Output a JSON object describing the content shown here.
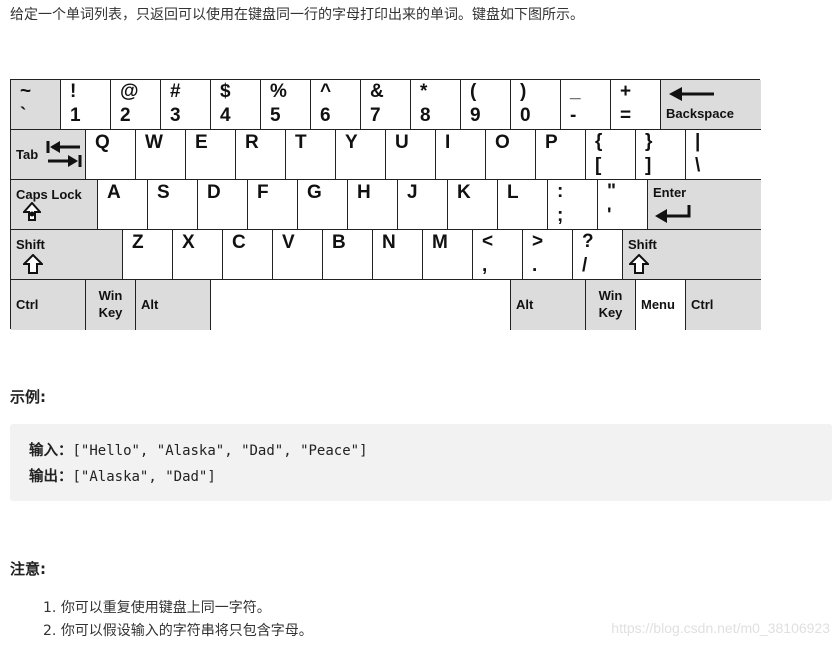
{
  "intro": "给定一个单词列表，只返回可以使用在键盘同一行的字母打印出来的单词。键盘如下图所示。",
  "keyboard": {
    "r0": [
      {
        "top": "~",
        "bottom": "`"
      },
      {
        "top": "!",
        "bottom": "1"
      },
      {
        "top": "@",
        "bottom": "2"
      },
      {
        "top": "#",
        "bottom": "3"
      },
      {
        "top": "$",
        "bottom": "4"
      },
      {
        "top": "%",
        "bottom": "5"
      },
      {
        "top": "^",
        "bottom": "6"
      },
      {
        "top": "&",
        "bottom": "7"
      },
      {
        "top": "*",
        "bottom": "8"
      },
      {
        "top": "(",
        "bottom": "9"
      },
      {
        "top": ")",
        "bottom": "0"
      },
      {
        "top": "_",
        "bottom": "-"
      },
      {
        "top": "+",
        "bottom": "="
      },
      {
        "label": "Backspace"
      }
    ],
    "r1": [
      {
        "label": "Tab"
      },
      {
        "main": "Q"
      },
      {
        "main": "W"
      },
      {
        "main": "E"
      },
      {
        "main": "R"
      },
      {
        "main": "T"
      },
      {
        "main": "Y"
      },
      {
        "main": "U"
      },
      {
        "main": "I"
      },
      {
        "main": "O"
      },
      {
        "main": "P"
      },
      {
        "top": "{",
        "bottom": "["
      },
      {
        "top": "}",
        "bottom": "]"
      },
      {
        "top": "|",
        "bottom": "\\"
      }
    ],
    "r2": [
      {
        "label": "Caps Lock"
      },
      {
        "main": "A"
      },
      {
        "main": "S"
      },
      {
        "main": "D"
      },
      {
        "main": "F"
      },
      {
        "main": "G"
      },
      {
        "main": "H"
      },
      {
        "main": "J"
      },
      {
        "main": "K"
      },
      {
        "main": "L"
      },
      {
        "top": ":",
        "bottom": ";"
      },
      {
        "top": "\"",
        "bottom": "'"
      },
      {
        "label": "Enter"
      }
    ],
    "r3": [
      {
        "label": "Shift"
      },
      {
        "main": "Z"
      },
      {
        "main": "X"
      },
      {
        "main": "C"
      },
      {
        "main": "V"
      },
      {
        "main": "B"
      },
      {
        "main": "N"
      },
      {
        "main": "M"
      },
      {
        "top": "<",
        "bottom": ","
      },
      {
        "top": ">",
        "bottom": "."
      },
      {
        "top": "?",
        "bottom": "/"
      },
      {
        "label": "Shift"
      }
    ],
    "r4": [
      {
        "label": "Ctrl"
      },
      {
        "line1": "Win",
        "line2": "Key"
      },
      {
        "label": "Alt"
      },
      {
        "label": ""
      },
      {
        "label": "Alt"
      },
      {
        "line1": "Win",
        "line2": "Key"
      },
      {
        "label": "Menu"
      },
      {
        "label": "Ctrl"
      }
    ],
    "gray_key_color": "#dcdcdc"
  },
  "example": {
    "title": "示例:",
    "input_label": "输入",
    "input_value": "[\"Hello\", \"Alaska\", \"Dad\", \"Peace\"]",
    "output_label": "输出",
    "output_value": "[\"Alaska\", \"Dad\"]",
    "separator": "："
  },
  "notes": {
    "title": "注意:",
    "items": [
      "你可以重复使用键盘上同一字符。",
      "你可以假设输入的字符串将只包含字母。"
    ]
  },
  "watermark": "https://blog.csdn.net/m0_38106923"
}
